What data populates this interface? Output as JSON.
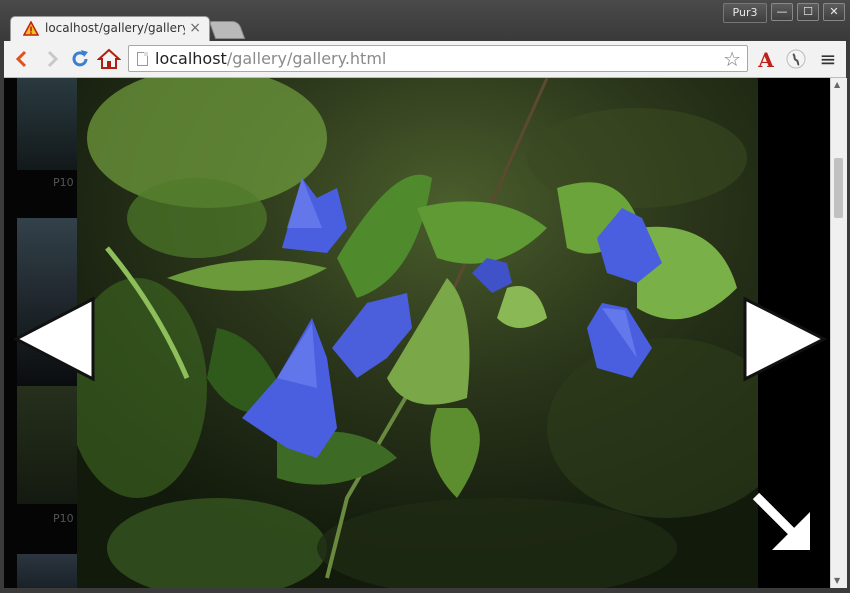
{
  "window": {
    "profile_label": "Pur3",
    "minimize_label": "—",
    "maximize_label": "☐",
    "close_label": "✕"
  },
  "tabs": [
    {
      "title": "localhost/gallery/gallery.html",
      "close_label": "×"
    }
  ],
  "toolbar": {
    "back_icon": "chevron-left-icon",
    "forward_icon": "chevron-right-icon",
    "reload_icon": "reload-icon",
    "home_icon": "home-icon",
    "url_host": "localhost",
    "url_path": "/gallery/gallery.html",
    "star_label": "☆",
    "menu_label": "≡"
  },
  "gallery": {
    "thumb_labels": [
      "P10",
      "P10"
    ],
    "prev_icon": "triangle-left-icon",
    "next_icon": "triangle-right-icon",
    "expand_icon": "arrow-down-right-icon"
  },
  "colors": {
    "tab_bg": "#f2f2f2",
    "chrome_dark": "#3b3b3b",
    "flower_blue": "#4a5fe0",
    "leaf_green": "#5a8f2e"
  }
}
